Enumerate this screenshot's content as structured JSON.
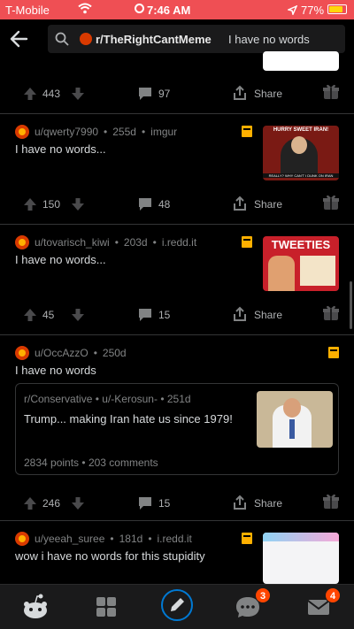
{
  "status_bar": {
    "carrier": "T-Mobile",
    "time": "7:46 AM",
    "battery": "77%"
  },
  "search": {
    "subreddit": "r/TheRightCantMeme",
    "query": "I have no words"
  },
  "posts": [
    {
      "score": "443",
      "comments": "97",
      "share_label": "Share"
    },
    {
      "author": "u/qwerty7990",
      "age": "255d",
      "domain": "imgur",
      "title": "I have no words...",
      "score": "150",
      "comments": "48",
      "share_label": "Share",
      "thumb_text": "HURRY SWEET IRAN!",
      "thumb_caption": "REALLY? WHY CAN'T I DUNK ON IRAN"
    },
    {
      "author": "u/tovarisch_kiwi",
      "age": "203d",
      "domain": "i.redd.it",
      "title": "I have no words...",
      "score": "45",
      "comments": "15",
      "share_label": "Share",
      "thumb_text": "TWEETIES"
    },
    {
      "author": "u/OccAzzO",
      "age": "250d",
      "title": "I have no words",
      "crosspost": {
        "subreddit": "r/Conservative",
        "author": "u/-Kerosun-",
        "age": "251d",
        "title": "Trump... making Iran hate us since 1979!",
        "points": "2834 points",
        "comments": "203 comments"
      },
      "score": "246",
      "comments": "15",
      "share_label": "Share"
    },
    {
      "author": "u/yeeah_suree",
      "age": "181d",
      "domain": "i.redd.it",
      "title": "wow i have no words for this stupidity"
    }
  ],
  "tabbar": {
    "chat_badge": "3",
    "inbox_badge": "4"
  },
  "colors": {
    "status_bar": "#ef4f54",
    "accent": "#ff4500",
    "flag": "#ffb000"
  }
}
